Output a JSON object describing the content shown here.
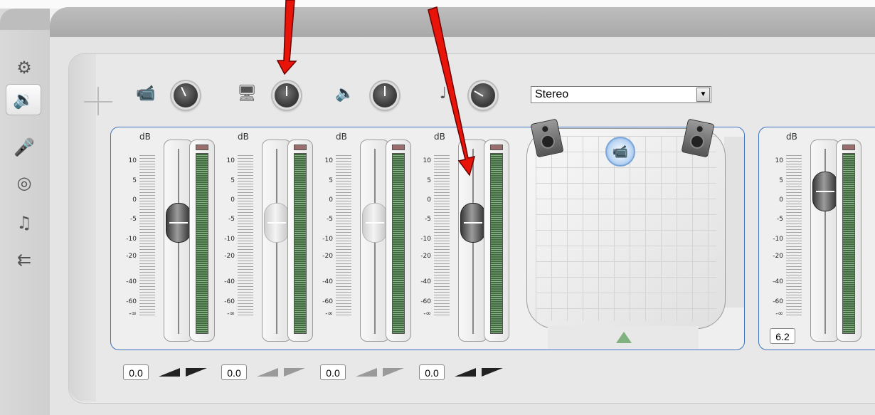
{
  "sidebar": {
    "items": [
      {
        "name": "routing",
        "icon": "routing-icon",
        "glyph": "⚙",
        "active": false
      },
      {
        "name": "audio-mixer",
        "icon": "speaker-icon",
        "glyph": "🔉",
        "active": true
      },
      {
        "name": "voiceover",
        "icon": "microphone-icon",
        "glyph": "🎤",
        "active": false
      },
      {
        "name": "disc",
        "icon": "disc-icon",
        "glyph": "◎",
        "active": false
      },
      {
        "name": "music",
        "icon": "music-notes-icon",
        "glyph": "♫",
        "active": false
      },
      {
        "name": "plugin",
        "icon": "plugin-icon",
        "glyph": "⇇",
        "active": false
      }
    ]
  },
  "sources": [
    {
      "icon": "camera-audio-icon",
      "glyph": "📹"
    },
    {
      "icon": "video-audio-icon",
      "glyph": "🖥"
    },
    {
      "icon": "speaker-icon",
      "glyph": "🔈"
    },
    {
      "icon": "music-note-icon",
      "glyph": "♩"
    }
  ],
  "output_mode": {
    "selected": "Stereo"
  },
  "channels": [
    {
      "db_label": "dB",
      "value": "0.0",
      "level": 0.62
    },
    {
      "db_label": "dB",
      "value": "0.0",
      "level": 0.62
    },
    {
      "db_label": "dB",
      "value": "0.0",
      "level": 0.62
    },
    {
      "db_label": "dB",
      "value": "0.0",
      "level": 0.62
    }
  ],
  "master": {
    "db_label": "dB",
    "value": "6.2",
    "level": 0.82
  },
  "scale_ticks": [
    "10",
    "5",
    "0",
    "-5",
    "-10",
    "-20",
    "-40",
    "-60",
    "-∞"
  ],
  "colors": {
    "accent_border": "#3c74c0",
    "arrow": "#e8140a",
    "meter_green": "#3f6b3f",
    "meter_peak": "#9b6e6e"
  }
}
